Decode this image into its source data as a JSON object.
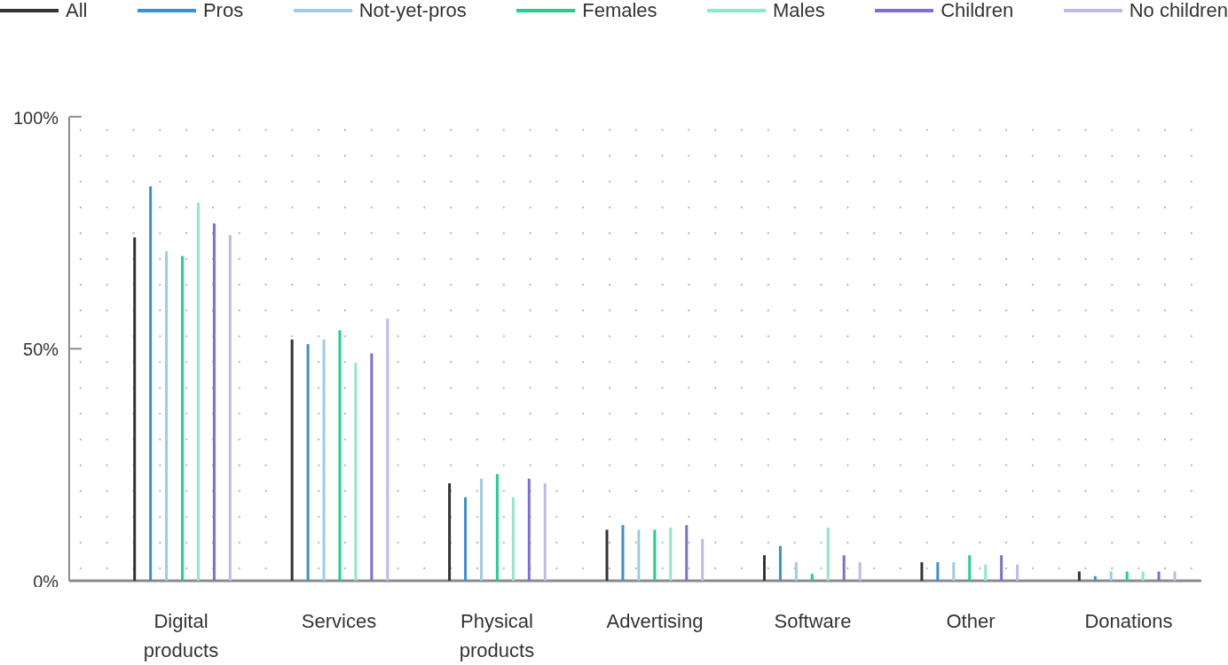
{
  "chart": {
    "chart_data": {
      "type": "bar",
      "categories": [
        "Digital products",
        "Services",
        "Physical products",
        "Advertising",
        "Software",
        "Other",
        "Donations"
      ],
      "series": [
        {
          "name": "All",
          "color": "#333333",
          "values": [
            74,
            52,
            21,
            11,
            5.5,
            4,
            2
          ]
        },
        {
          "name": "Pros",
          "color": "#3a8fd6",
          "values": [
            85,
            51,
            18,
            12,
            7.5,
            4,
            1
          ]
        },
        {
          "name": "Not-yet-pros",
          "color": "#9ecae9",
          "values": [
            71,
            52,
            22,
            11,
            4,
            4,
            2
          ]
        },
        {
          "name": "Females",
          "color": "#1fd18a",
          "values": [
            70,
            54,
            23,
            11,
            1.5,
            5.5,
            2
          ]
        },
        {
          "name": "Males",
          "color": "#8fe8c6",
          "values": [
            81.5,
            47,
            18,
            11.5,
            11.5,
            3.5,
            2
          ]
        },
        {
          "name": "Children",
          "color": "#7b6fd6",
          "values": [
            77,
            49,
            22,
            12,
            5.5,
            5.5,
            2
          ]
        },
        {
          "name": "No children",
          "color": "#bfb8ec",
          "values": [
            74.5,
            56.5,
            21,
            9,
            4,
            3.5,
            2
          ]
        }
      ],
      "legend": "top",
      "ylim": [
        0,
        100
      ],
      "yticks": [
        {
          "value": 0,
          "label": "0%"
        },
        {
          "value": 50,
          "label": "50%"
        },
        {
          "value": 100,
          "label": "100%"
        }
      ]
    }
  }
}
